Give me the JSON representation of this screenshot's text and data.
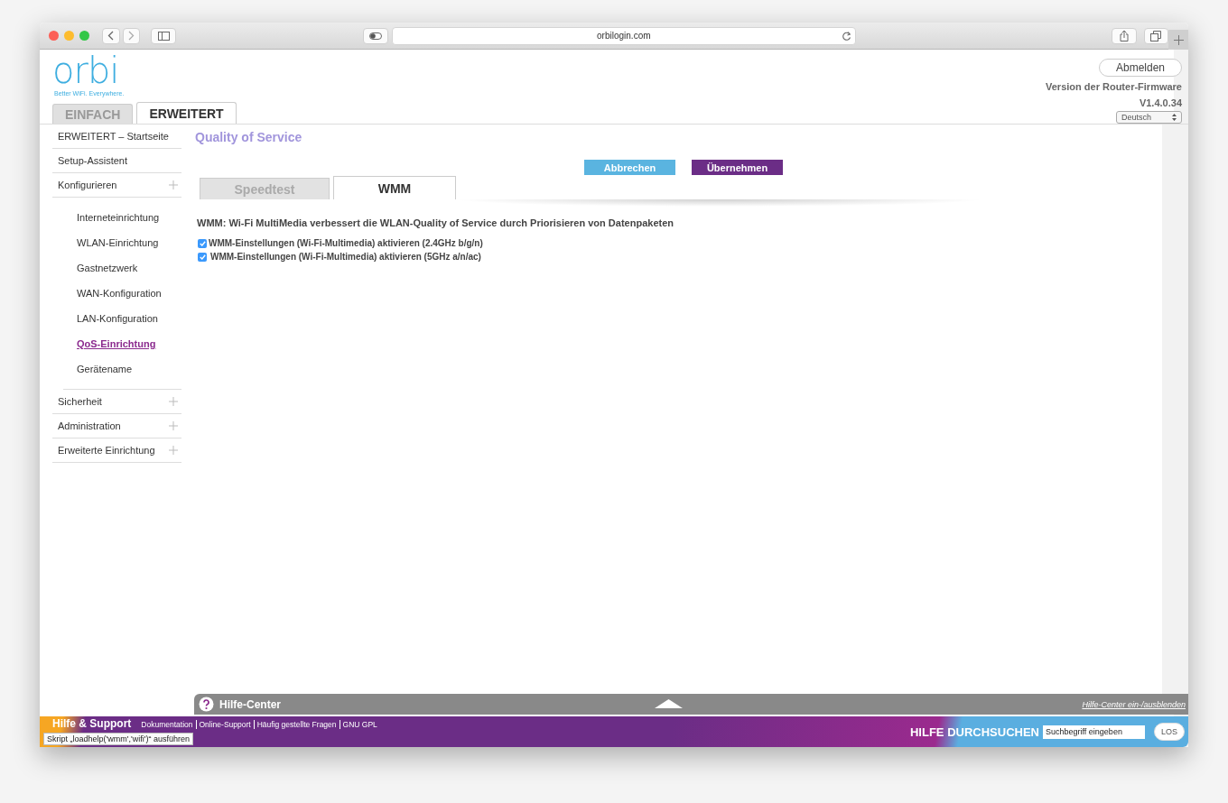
{
  "browser": {
    "url": "orbilogin.com"
  },
  "header": {
    "logo": "orbi",
    "tagline": "Better WiFi. Everywhere.",
    "logout": "Abmelden",
    "firmware_label": "Version der Router-Firmware",
    "firmware_version": "V1.4.0.34",
    "language": "Deutsch",
    "mode_tabs": [
      {
        "label": "EINFACH",
        "selected": false
      },
      {
        "label": "ERWEITERT",
        "selected": true
      }
    ]
  },
  "sidebar": {
    "items": [
      {
        "label": "ERWEITERT – Startseite",
        "expandable": false
      },
      {
        "label": "Setup-Assistent",
        "expandable": false
      },
      {
        "label": "Konfigurieren",
        "expandable": true,
        "children": [
          {
            "label": "Interneteinrichtung",
            "selected": false
          },
          {
            "label": "WLAN-Einrichtung",
            "selected": false
          },
          {
            "label": "Gastnetzwerk",
            "selected": false
          },
          {
            "label": "WAN-Konfiguration",
            "selected": false
          },
          {
            "label": "LAN-Konfiguration",
            "selected": false
          },
          {
            "label": "QoS-Einrichtung",
            "selected": true
          },
          {
            "label": "Gerätename",
            "selected": false
          }
        ]
      },
      {
        "label": "Sicherheit",
        "expandable": true
      },
      {
        "label": "Administration",
        "expandable": true
      },
      {
        "label": "Erweiterte Einrichtung",
        "expandable": true
      }
    ]
  },
  "page": {
    "title": "Quality of Service",
    "buttons": [
      {
        "label": "Abbrechen",
        "kind": "cancel"
      },
      {
        "label": "Übernehmen",
        "kind": "apply"
      }
    ],
    "tabs": [
      {
        "label": "Speedtest",
        "selected": false
      },
      {
        "label": "WMM",
        "selected": true
      }
    ],
    "description": "WMM: Wi-Fi MultiMedia verbessert die WLAN-Quality of Service durch Priorisieren von Datenpaketen",
    "options": [
      {
        "label": "WMM-Einstellungen (Wi-Fi-Multimedia) aktivieren (2.4GHz b/g/n)",
        "checked": true
      },
      {
        "label": "WMM-Einstellungen (Wi-Fi-Multimedia) aktivieren (5GHz a/n/ac)",
        "checked": true
      }
    ]
  },
  "help_bar": {
    "title": "Hilfe-Center",
    "toggle_link": "Hilfe-Center ein-/ausblenden"
  },
  "footer": {
    "title": "Hilfe & Support",
    "links": [
      "Dokumentation",
      "Online-Support",
      "Häufig gestellte Fragen",
      "GNU GPL"
    ],
    "search_label": "HILFE DURCHSUCHEN",
    "search_placeholder": "Suchbegriff eingeben",
    "search_button": "LOS"
  },
  "status_tooltip": "Skript „loadhelp('wmm','wifi')“ ausführen"
}
